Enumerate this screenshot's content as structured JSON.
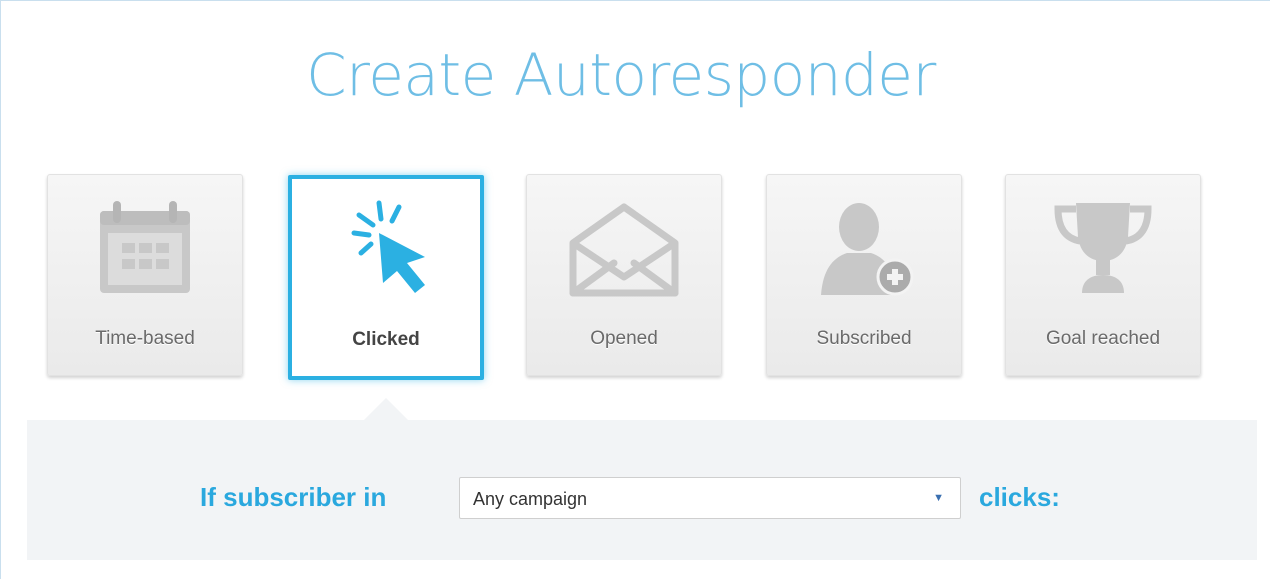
{
  "page": {
    "title": "Create Autoresponder"
  },
  "triggers": [
    {
      "label": "Time-based",
      "icon": "calendar-icon",
      "selected": false
    },
    {
      "label": "Clicked",
      "icon": "cursor-click-icon",
      "selected": true
    },
    {
      "label": "Opened",
      "icon": "open-envelope-icon",
      "selected": false
    },
    {
      "label": "Subscribed",
      "icon": "add-user-icon",
      "selected": false
    },
    {
      "label": "Goal reached",
      "icon": "trophy-icon",
      "selected": false
    }
  ],
  "condition": {
    "prefix": "If subscriber in",
    "campaign_select": {
      "value": "Any campaign"
    },
    "suffix": "clicks:"
  },
  "colors": {
    "accent": "#2bb0e2",
    "title": "#5cb6e2",
    "icon_gray": "#c8c8c8",
    "panel_bg": "#f2f4f6"
  }
}
